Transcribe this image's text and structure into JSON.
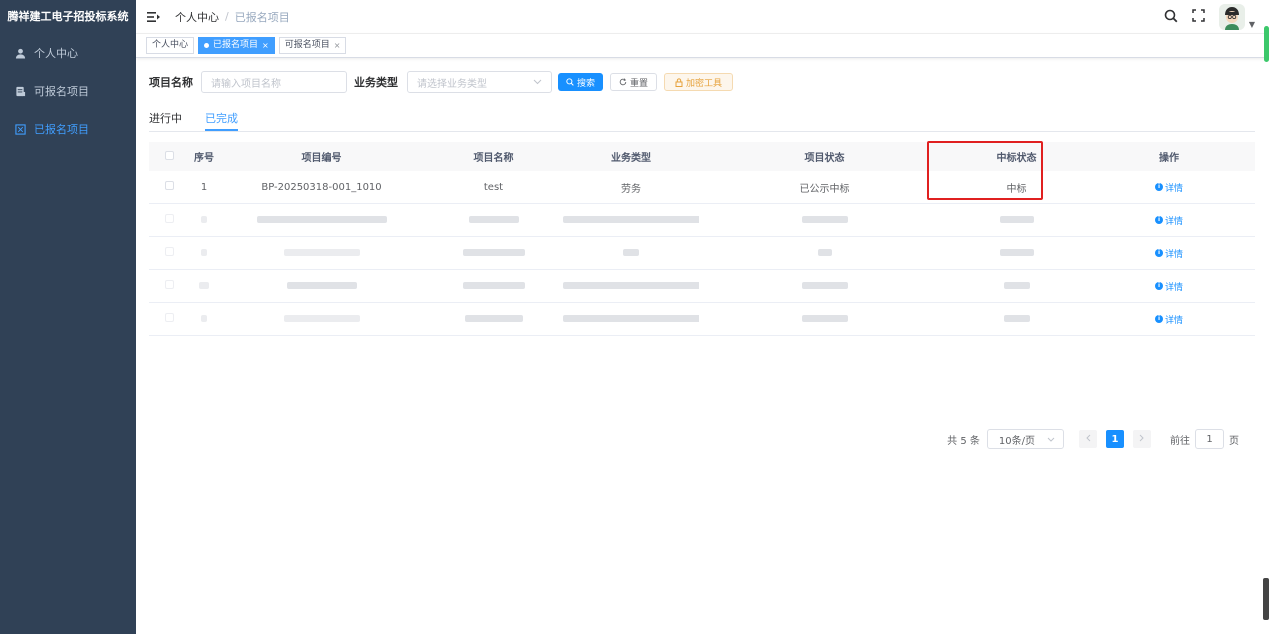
{
  "app": {
    "title": "腾祥建工电子招投标系统"
  },
  "sidebar": {
    "items": [
      {
        "label": "个人中心",
        "icon": "user-icon",
        "active": false
      },
      {
        "label": "可报名项目",
        "icon": "document-icon",
        "active": false
      },
      {
        "label": "已报名项目",
        "icon": "checkbox-icon",
        "active": true
      }
    ]
  },
  "navbar": {
    "breadcrumb_home": "个人中心",
    "breadcrumb_sep": "/",
    "breadcrumb_current": "已报名项目"
  },
  "tagsview": {
    "tags": [
      {
        "label": "个人中心",
        "active": false,
        "closable": false
      },
      {
        "label": "已报名项目",
        "active": true,
        "closable": true
      },
      {
        "label": "可报名项目",
        "active": false,
        "closable": true
      }
    ],
    "close_glyph": "×"
  },
  "search": {
    "name_label": "项目名称",
    "name_placeholder": "请输入项目名称",
    "type_label": "业务类型",
    "type_placeholder": "请选择业务类型",
    "search_button": "搜索",
    "reset_button": "重置",
    "tool_button": "加密工具"
  },
  "tabs": {
    "in_progress": "进行中",
    "completed": "已完成",
    "active": "completed"
  },
  "table": {
    "headers": [
      "序号",
      "项目编号",
      "项目名称",
      "业务类型",
      "项目状态",
      "中标状态",
      "操作"
    ],
    "rows": [
      {
        "index": "1",
        "code": "BP-20250318-001_1010",
        "name": "test",
        "type": "劳务",
        "status": "已公示中标",
        "bid": "中标",
        "action": "详情"
      }
    ],
    "action_label": "详情"
  },
  "pagination": {
    "total": "共 5 条",
    "page_size": "10条/页",
    "current_page": "1",
    "goto_label": "前往",
    "goto_value": "1",
    "page_suffix": "页"
  },
  "colors": {
    "sidebar_bg": "#304156",
    "primary": "#1890ff",
    "highlight_border": "#e02020"
  }
}
